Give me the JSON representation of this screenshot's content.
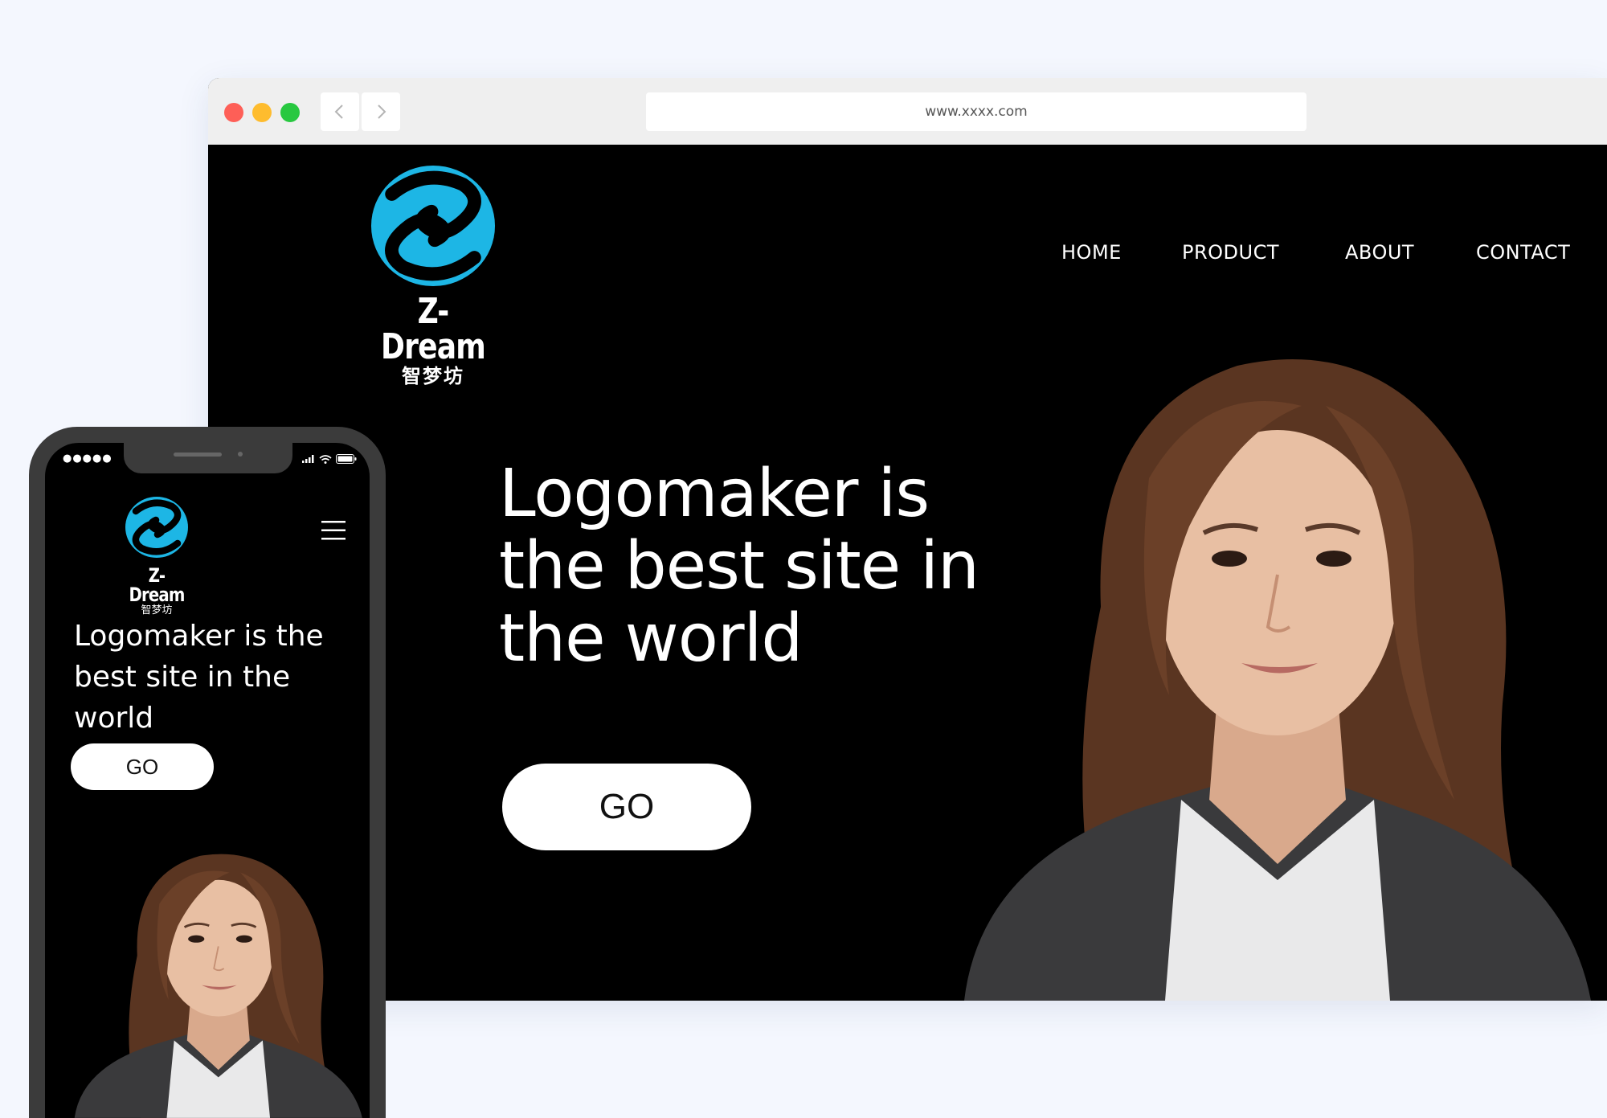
{
  "browser": {
    "url": "www.xxxx.com"
  },
  "brand": {
    "name": "Z-Dream",
    "name_cn": "智梦坊",
    "logo_color": "#1db6e5"
  },
  "nav": {
    "home": "HOME",
    "product": "PRODUCT",
    "about": "ABOUT",
    "contact": "CONTACT"
  },
  "hero": {
    "headline": "Logomaker is the best site in the world",
    "cta_label": "GO"
  },
  "mobile": {
    "signal": "●●●●●"
  },
  "icons": {
    "back": "chevron-left-icon",
    "forward": "chevron-right-icon",
    "menu": "hamburger-menu-icon",
    "wifi": "wifi-icon",
    "battery": "battery-icon",
    "cellular": "cellular-signal-icon"
  }
}
